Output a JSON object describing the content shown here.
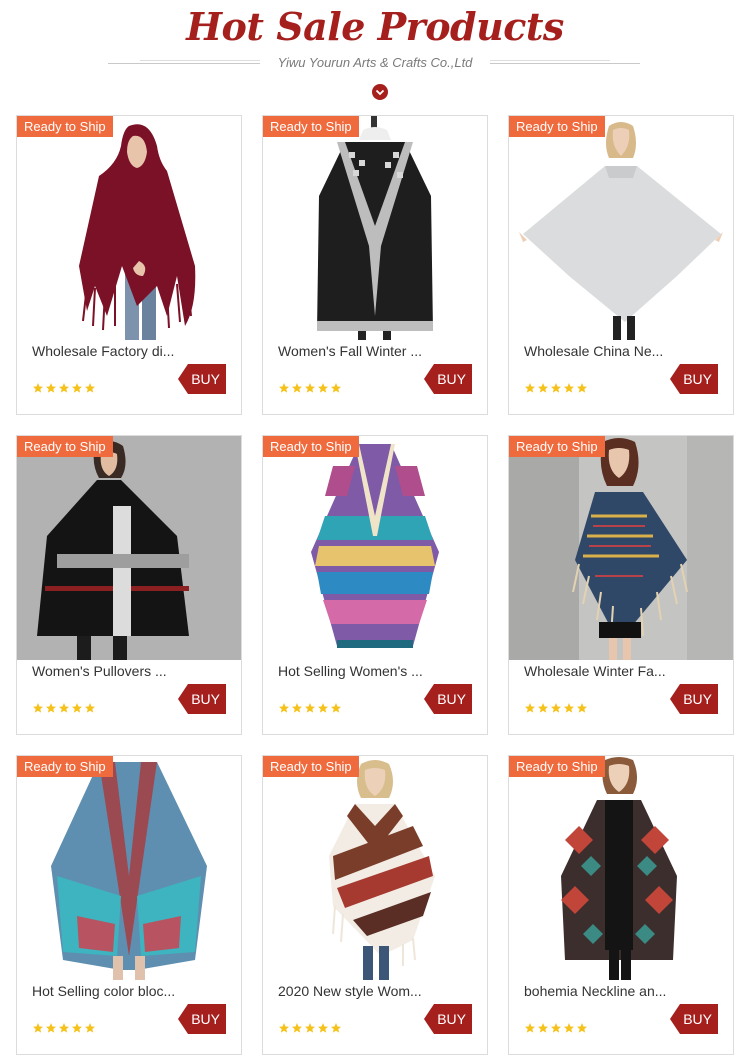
{
  "header": {
    "title": "Hot Sale Products",
    "subtitle": "Yiwu Yourun Arts & Crafts Co.,Ltd"
  },
  "colors": {
    "brand": "#a51f1d",
    "badge": "#ef6a3d",
    "star": "#f5c21b"
  },
  "products": [
    {
      "badge": "Ready to Ship",
      "name": "Wholesale Factory di...",
      "rating": 5,
      "buy_label": "BUY"
    },
    {
      "badge": "Ready to Ship",
      "name": "Women's Fall Winter ...",
      "rating": 5,
      "buy_label": "BUY"
    },
    {
      "badge": "Ready to Ship",
      "name": "Wholesale China Ne...",
      "rating": 5,
      "buy_label": "BUY"
    },
    {
      "badge": "Ready to Ship",
      "name": "Women's Pullovers ...",
      "rating": 5,
      "buy_label": "BUY"
    },
    {
      "badge": "Ready to Ship",
      "name": "Hot Selling Women's ...",
      "rating": 5,
      "buy_label": "BUY"
    },
    {
      "badge": "Ready to Ship",
      "name": "Wholesale Winter Fa...",
      "rating": 5,
      "buy_label": "BUY"
    },
    {
      "badge": "Ready to Ship",
      "name": "Hot Selling color bloc...",
      "rating": 5,
      "buy_label": "BUY"
    },
    {
      "badge": "Ready to Ship",
      "name": "2020 New style Wom...",
      "rating": 5,
      "buy_label": "BUY"
    },
    {
      "badge": "Ready to Ship",
      "name": "bohemia Neckline an...",
      "rating": 5,
      "buy_label": "BUY"
    }
  ]
}
